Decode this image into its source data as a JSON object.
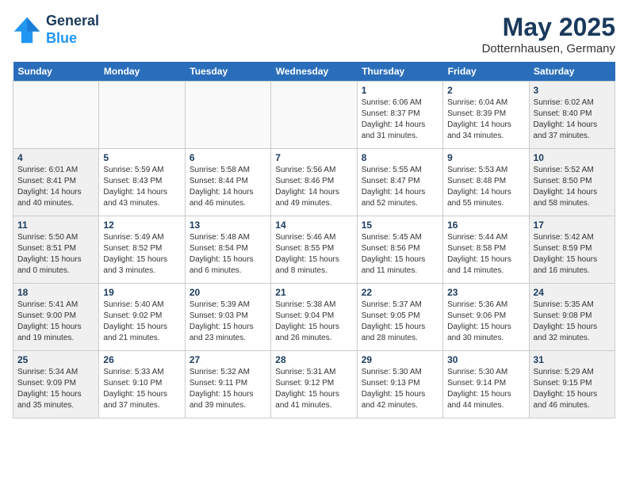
{
  "header": {
    "logo_line1": "General",
    "logo_line2": "Blue",
    "month_title": "May 2025",
    "location": "Dotternhausen, Germany"
  },
  "weekdays": [
    "Sunday",
    "Monday",
    "Tuesday",
    "Wednesday",
    "Thursday",
    "Friday",
    "Saturday"
  ],
  "weeks": [
    [
      {
        "day": "",
        "detail": "",
        "empty": true
      },
      {
        "day": "",
        "detail": "",
        "empty": true
      },
      {
        "day": "",
        "detail": "",
        "empty": true
      },
      {
        "day": "",
        "detail": "",
        "empty": true
      },
      {
        "day": "1",
        "detail": "Sunrise: 6:06 AM\nSunset: 8:37 PM\nDaylight: 14 hours\nand 31 minutes."
      },
      {
        "day": "2",
        "detail": "Sunrise: 6:04 AM\nSunset: 8:39 PM\nDaylight: 14 hours\nand 34 minutes."
      },
      {
        "day": "3",
        "detail": "Sunrise: 6:02 AM\nSunset: 8:40 PM\nDaylight: 14 hours\nand 37 minutes."
      }
    ],
    [
      {
        "day": "4",
        "detail": "Sunrise: 6:01 AM\nSunset: 8:41 PM\nDaylight: 14 hours\nand 40 minutes."
      },
      {
        "day": "5",
        "detail": "Sunrise: 5:59 AM\nSunset: 8:43 PM\nDaylight: 14 hours\nand 43 minutes."
      },
      {
        "day": "6",
        "detail": "Sunrise: 5:58 AM\nSunset: 8:44 PM\nDaylight: 14 hours\nand 46 minutes."
      },
      {
        "day": "7",
        "detail": "Sunrise: 5:56 AM\nSunset: 8:46 PM\nDaylight: 14 hours\nand 49 minutes."
      },
      {
        "day": "8",
        "detail": "Sunrise: 5:55 AM\nSunset: 8:47 PM\nDaylight: 14 hours\nand 52 minutes."
      },
      {
        "day": "9",
        "detail": "Sunrise: 5:53 AM\nSunset: 8:48 PM\nDaylight: 14 hours\nand 55 minutes."
      },
      {
        "day": "10",
        "detail": "Sunrise: 5:52 AM\nSunset: 8:50 PM\nDaylight: 14 hours\nand 58 minutes."
      }
    ],
    [
      {
        "day": "11",
        "detail": "Sunrise: 5:50 AM\nSunset: 8:51 PM\nDaylight: 15 hours\nand 0 minutes."
      },
      {
        "day": "12",
        "detail": "Sunrise: 5:49 AM\nSunset: 8:52 PM\nDaylight: 15 hours\nand 3 minutes."
      },
      {
        "day": "13",
        "detail": "Sunrise: 5:48 AM\nSunset: 8:54 PM\nDaylight: 15 hours\nand 6 minutes."
      },
      {
        "day": "14",
        "detail": "Sunrise: 5:46 AM\nSunset: 8:55 PM\nDaylight: 15 hours\nand 8 minutes."
      },
      {
        "day": "15",
        "detail": "Sunrise: 5:45 AM\nSunset: 8:56 PM\nDaylight: 15 hours\nand 11 minutes."
      },
      {
        "day": "16",
        "detail": "Sunrise: 5:44 AM\nSunset: 8:58 PM\nDaylight: 15 hours\nand 14 minutes."
      },
      {
        "day": "17",
        "detail": "Sunrise: 5:42 AM\nSunset: 8:59 PM\nDaylight: 15 hours\nand 16 minutes."
      }
    ],
    [
      {
        "day": "18",
        "detail": "Sunrise: 5:41 AM\nSunset: 9:00 PM\nDaylight: 15 hours\nand 19 minutes."
      },
      {
        "day": "19",
        "detail": "Sunrise: 5:40 AM\nSunset: 9:02 PM\nDaylight: 15 hours\nand 21 minutes."
      },
      {
        "day": "20",
        "detail": "Sunrise: 5:39 AM\nSunset: 9:03 PM\nDaylight: 15 hours\nand 23 minutes."
      },
      {
        "day": "21",
        "detail": "Sunrise: 5:38 AM\nSunset: 9:04 PM\nDaylight: 15 hours\nand 26 minutes."
      },
      {
        "day": "22",
        "detail": "Sunrise: 5:37 AM\nSunset: 9:05 PM\nDaylight: 15 hours\nand 28 minutes."
      },
      {
        "day": "23",
        "detail": "Sunrise: 5:36 AM\nSunset: 9:06 PM\nDaylight: 15 hours\nand 30 minutes."
      },
      {
        "day": "24",
        "detail": "Sunrise: 5:35 AM\nSunset: 9:08 PM\nDaylight: 15 hours\nand 32 minutes."
      }
    ],
    [
      {
        "day": "25",
        "detail": "Sunrise: 5:34 AM\nSunset: 9:09 PM\nDaylight: 15 hours\nand 35 minutes."
      },
      {
        "day": "26",
        "detail": "Sunrise: 5:33 AM\nSunset: 9:10 PM\nDaylight: 15 hours\nand 37 minutes."
      },
      {
        "day": "27",
        "detail": "Sunrise: 5:32 AM\nSunset: 9:11 PM\nDaylight: 15 hours\nand 39 minutes."
      },
      {
        "day": "28",
        "detail": "Sunrise: 5:31 AM\nSunset: 9:12 PM\nDaylight: 15 hours\nand 41 minutes."
      },
      {
        "day": "29",
        "detail": "Sunrise: 5:30 AM\nSunset: 9:13 PM\nDaylight: 15 hours\nand 42 minutes."
      },
      {
        "day": "30",
        "detail": "Sunrise: 5:30 AM\nSunset: 9:14 PM\nDaylight: 15 hours\nand 44 minutes."
      },
      {
        "day": "31",
        "detail": "Sunrise: 5:29 AM\nSunset: 9:15 PM\nDaylight: 15 hours\nand 46 minutes."
      }
    ]
  ]
}
